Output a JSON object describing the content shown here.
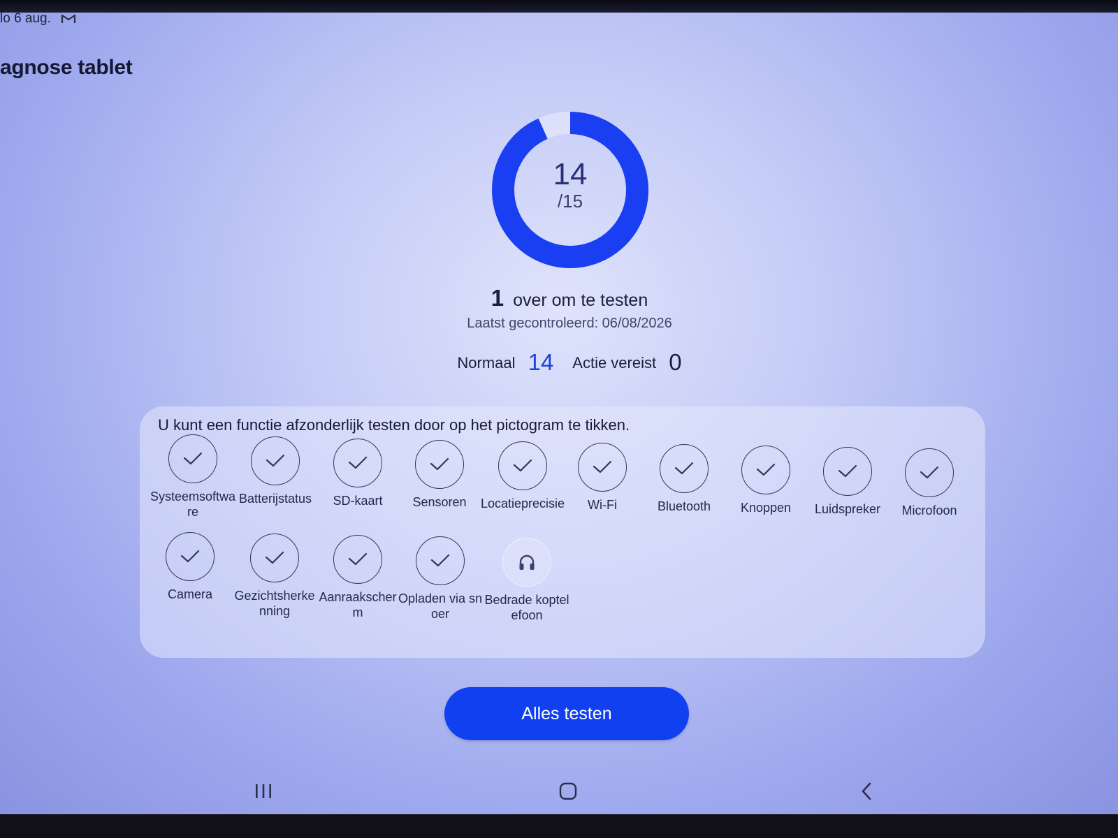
{
  "status_bar": {
    "date": "lo 6 aug.",
    "notification_icon": "gmail-icon"
  },
  "app": {
    "title": "agnose tablet"
  },
  "progress": {
    "done": "14",
    "total": "/15",
    "fraction": 0.9333
  },
  "remaining": {
    "count": "1",
    "text": "over om te testen"
  },
  "last_checked": "Laatst gecontroleerd: 06/08/2026",
  "summary": {
    "normal_label": "Normaal",
    "normal_value": "14",
    "action_label": "Actie vereist",
    "action_value": "0"
  },
  "panel": {
    "hint": "U kunt een functie afzonderlijk testen door op het pictogram te tikken.",
    "tests": [
      {
        "label": "Systeemsoftware",
        "status": "passed",
        "icon": "check-icon"
      },
      {
        "label": "Batterijstatus",
        "status": "passed",
        "icon": "check-icon"
      },
      {
        "label": "SD-kaart",
        "status": "passed",
        "icon": "check-icon"
      },
      {
        "label": "Sensoren",
        "status": "passed",
        "icon": "check-icon"
      },
      {
        "label": "Locatieprecisie",
        "status": "passed",
        "icon": "check-icon"
      },
      {
        "label": "Wi-Fi",
        "status": "passed",
        "icon": "check-icon"
      },
      {
        "label": "Bluetooth",
        "status": "passed",
        "icon": "check-icon"
      },
      {
        "label": "Knoppen",
        "status": "passed",
        "icon": "check-icon"
      },
      {
        "label": "Luidspreker",
        "status": "passed",
        "icon": "check-icon"
      },
      {
        "label": "Microfoon",
        "status": "passed",
        "icon": "check-icon"
      },
      {
        "label": "Camera",
        "status": "passed",
        "icon": "check-icon"
      },
      {
        "label": "Gezichtsherkenning",
        "status": "passed",
        "icon": "check-icon"
      },
      {
        "label": "Aanraakscherm",
        "status": "passed",
        "icon": "check-icon"
      },
      {
        "label": "Opladen via snoer",
        "status": "passed",
        "icon": "check-icon"
      },
      {
        "label": "Bedrade koptelefoon",
        "status": "pending",
        "icon": "headphones-icon"
      }
    ]
  },
  "button": {
    "label": "Alles testen"
  },
  "colors": {
    "accent": "#1140f0",
    "ring": "#1a3ef2",
    "check": "#33375a"
  },
  "nav": {
    "recent": "recent-apps-icon",
    "home": "home-icon",
    "back": "back-icon"
  }
}
